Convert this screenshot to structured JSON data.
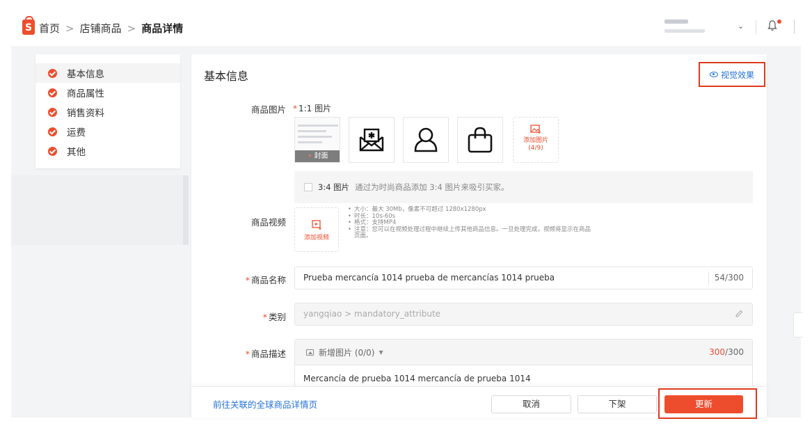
{
  "header": {
    "logo_glyph": "S",
    "breadcrumbs": [
      "首页",
      "店铺商品",
      "商品详情"
    ],
    "breadcrumb_separator": ">",
    "account_chevron": "⌄"
  },
  "sidebar": {
    "items": [
      {
        "label": "基本信息",
        "active": true
      },
      {
        "label": "商品属性",
        "active": false
      },
      {
        "label": "销售资料",
        "active": false
      },
      {
        "label": "运费",
        "active": false
      },
      {
        "label": "其他",
        "active": false
      }
    ]
  },
  "main": {
    "section_title": "基本信息",
    "visual_effect_link": "视觉效果",
    "product_images": {
      "label": "商品图片",
      "ratio_label": "1:1 图片",
      "cover_label": "封面",
      "add_label": "添加图片",
      "add_count": "(4/9)",
      "icons": [
        "envelope-icon",
        "person-icon",
        "shopping-bag-icon"
      ]
    },
    "ratio34": {
      "title": "3:4 图片",
      "hint": "通过为时尚商品添加 3:4 图片来吸引买家。"
    },
    "product_video": {
      "label": "商品视频",
      "add_label": "添加视频",
      "notes": [
        "大小：最大 30Mb，像素不可超过 1280x1280px",
        "时长：10s-60s",
        "格式：支持MP4",
        "注意：您可以在视频处理过程中继续上传其他商品信息。一旦处理完成，视频将显示在商品",
        "页面。"
      ]
    },
    "product_name": {
      "label": "商品名称",
      "value": "Prueba mercancía 1014 prueba de mercancías 1014 prueba",
      "counter": "54/300"
    },
    "category": {
      "label": "类别",
      "value": "yangqiao > mandatory_attribute"
    },
    "description": {
      "label": "商品描述",
      "add_image": "新增图片 (0/0)",
      "count_current": "300",
      "count_max": "/300",
      "text": "Mercancía de prueba 1014 mercancía de prueba 1014"
    }
  },
  "footer": {
    "global_link": "前往关联的全球商品详情页",
    "cancel": "取消",
    "delist": "下架",
    "update": "更新"
  },
  "colors": {
    "brand": "#ee4d2d",
    "link": "#2673dd",
    "highlight": "#e03a1a"
  }
}
